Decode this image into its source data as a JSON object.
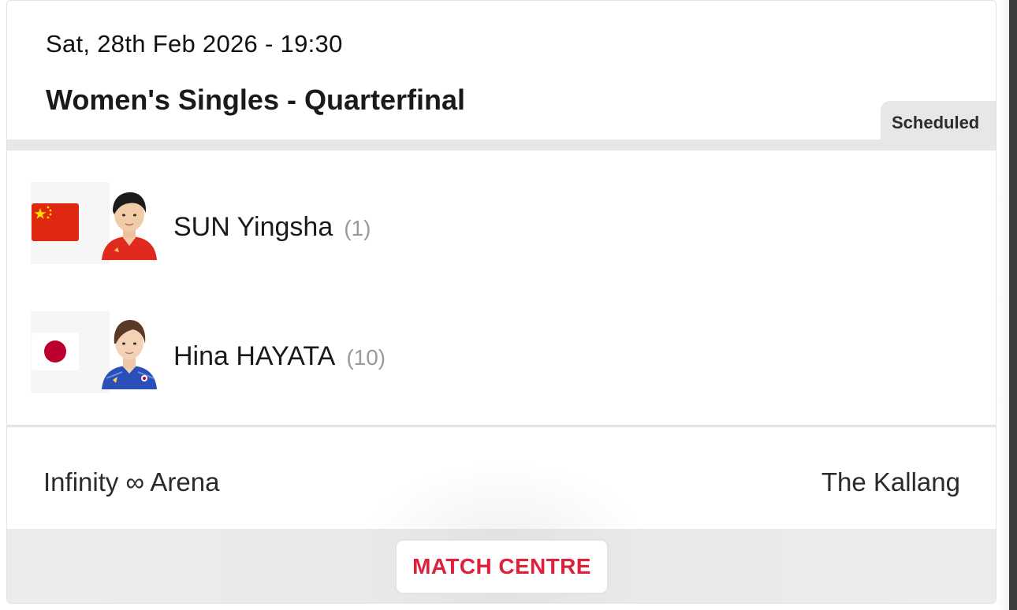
{
  "match": {
    "datetime": "Sat, 28th Feb 2026 - 19:30",
    "title": "Women's Singles - Quarterfinal",
    "status": "Scheduled"
  },
  "players": [
    {
      "name": "SUN Yingsha",
      "seed": "(1)",
      "flag_icon": "china-flag-icon",
      "avatar_icon": "player-photo"
    },
    {
      "name": "Hina HAYATA",
      "seed": "(10)",
      "flag_icon": "japan-flag-icon",
      "avatar_icon": "player-photo"
    }
  ],
  "venue": {
    "name": "Infinity ∞ Arena",
    "city": "The Kallang"
  },
  "footer": {
    "match_centre_label": "MATCH CENTRE"
  },
  "colors": {
    "accent": "#e0203a",
    "badge_bg": "#e8e6e6",
    "seed_text": "#9a9a9a"
  }
}
